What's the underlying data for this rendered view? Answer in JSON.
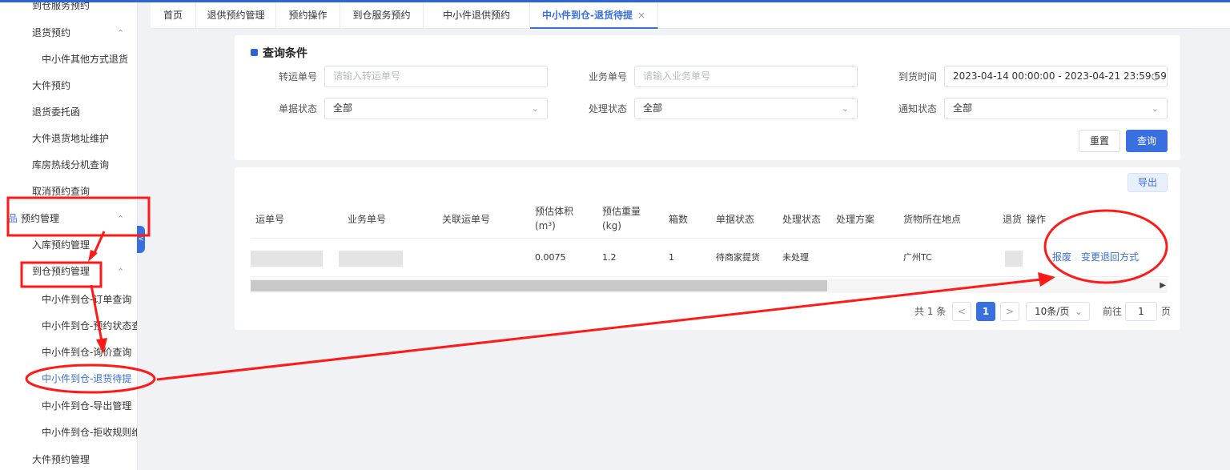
{
  "sidebar": {
    "items": [
      {
        "label": "到仓服务预约",
        "chevron": ""
      },
      {
        "label": "退货预约",
        "chevron": "^"
      },
      {
        "label": "中小件其他方式退货",
        "chevron": ""
      },
      {
        "label": "大件预约",
        "chevron": ""
      },
      {
        "label": "退货委托函",
        "chevron": ""
      },
      {
        "label": "大件退货地址维护",
        "chevron": ""
      },
      {
        "label": "库房热线分机查询",
        "chevron": ""
      },
      {
        "label": "取消预约查询",
        "chevron": ""
      },
      {
        "label": "预约管理",
        "chevron": "^",
        "icon": "品"
      },
      {
        "label": "入库预约管理",
        "chevron": ""
      },
      {
        "label": "到仓预约管理",
        "chevron": "^"
      },
      {
        "label": "中小件到仓-订单查询",
        "chevron": ""
      },
      {
        "label": "中小件到仓-预约状态查",
        "chevron": ""
      },
      {
        "label": "中小件到仓-询价查询",
        "chevron": ""
      },
      {
        "label": "中小件到仓-退货待提",
        "chevron": ""
      },
      {
        "label": "中小件到仓-导出管理",
        "chevron": ""
      },
      {
        "label": "中小件到仓-拒收规则维",
        "chevron": ""
      },
      {
        "label": "大件预约管理",
        "chevron": ""
      }
    ],
    "collapse_icon": "<"
  },
  "tabs": [
    {
      "label": "首页"
    },
    {
      "label": "退供预约管理"
    },
    {
      "label": "预约操作"
    },
    {
      "label": "到仓服务预约"
    },
    {
      "label": "中小件退供预约"
    },
    {
      "label": "中小件到仓-退货待提",
      "close": "×"
    }
  ],
  "search": {
    "title": "查询条件",
    "fields": {
      "transfer_no": {
        "label": "转运单号",
        "placeholder": "请输入转运单号"
      },
      "business_no": {
        "label": "业务单号",
        "placeholder": "请输入业务单号"
      },
      "arrival_time": {
        "label": "到货时间",
        "value": "2023-04-14 00:00:00 - 2023-04-21 23:59:59"
      },
      "doc_status": {
        "label": "单据状态",
        "value": "全部"
      },
      "process_status": {
        "label": "处理状态",
        "value": "全部"
      },
      "notify_status": {
        "label": "通知状态",
        "value": "全部"
      }
    },
    "reset_label": "重置",
    "query_label": "查询"
  },
  "results": {
    "export_label": "导出",
    "columns": {
      "waybill": "运单号",
      "business": "业务单号",
      "related": "关联运单号",
      "volume": "预估体积(m³)",
      "weight": "预估重量(kg)",
      "boxes": "箱数",
      "doc_status": "单据状态",
      "process_status": "处理状态",
      "process_plan": "处理方案",
      "location": "货物所在地点",
      "return": "退货",
      "ops": "操作"
    },
    "rows": [
      {
        "volume": "0.0075",
        "weight": "1.2",
        "boxes": "1",
        "doc_status": "待商家提货",
        "process_status": "未处理",
        "location": "广州TC",
        "op_scrap": "报废",
        "op_change": "变更退回方式"
      }
    ]
  },
  "pagination": {
    "total": "共 1 条",
    "prev": "<",
    "current": "1",
    "next": ">",
    "page_size": "10条/页",
    "goto_prefix": "前往",
    "goto_value": "1",
    "goto_suffix": "页"
  },
  "colors": {
    "accent": "#3a6fe0",
    "annotation": "#ff1a1a"
  }
}
